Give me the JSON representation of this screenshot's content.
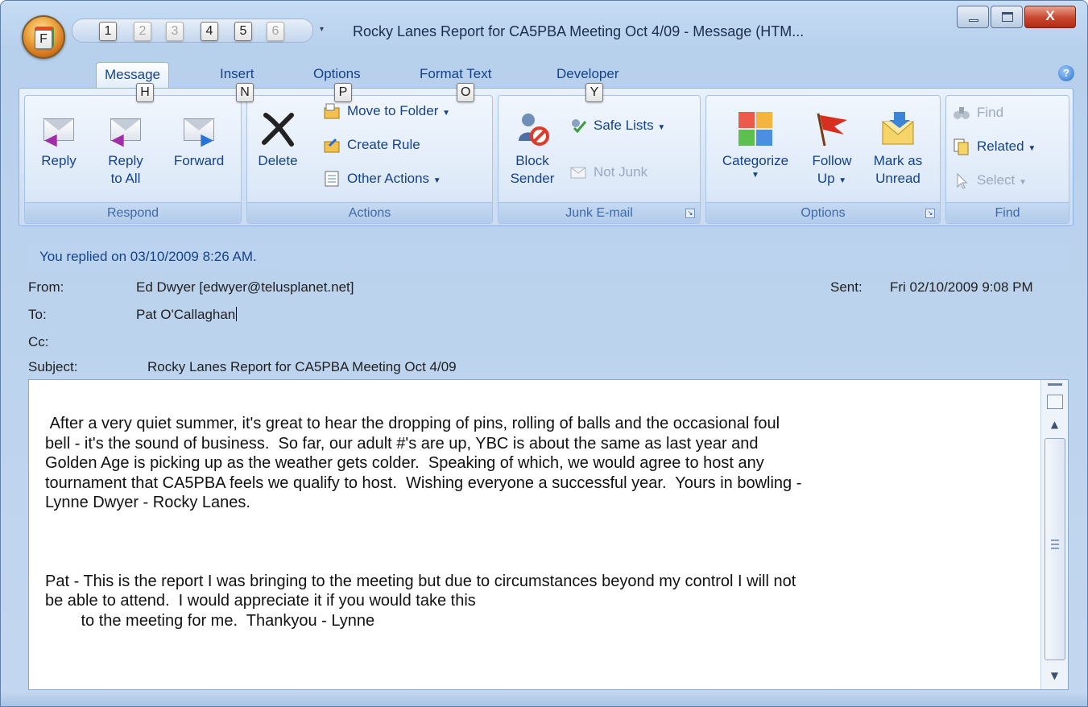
{
  "window": {
    "title": "Rocky Lanes Report for CA5PBA Meeting Oct 4/09 - Message (HTM..."
  },
  "office_button": {
    "keytip": "F"
  },
  "quick_access": {
    "keytips": [
      "1",
      "2",
      "3",
      "4",
      "5",
      "6"
    ],
    "dropdown_glyph": "▾"
  },
  "tabs": [
    {
      "label": "Message",
      "keytip": "H",
      "active": true
    },
    {
      "label": "Insert",
      "keytip": "N"
    },
    {
      "label": "Options",
      "keytip": "P"
    },
    {
      "label": "Format Text",
      "keytip": "O"
    },
    {
      "label": "Developer",
      "keytip": "Y"
    }
  ],
  "ribbon": {
    "respond": {
      "label": "Respond",
      "reply": "Reply",
      "reply_all_line1": "Reply",
      "reply_all_line2": "to All",
      "forward": "Forward"
    },
    "actions": {
      "label": "Actions",
      "delete": "Delete",
      "move_to_folder": "Move to Folder",
      "create_rule": "Create Rule",
      "other_actions": "Other Actions"
    },
    "junk": {
      "label": "Junk E-mail",
      "block_sender_line1": "Block",
      "block_sender_line2": "Sender",
      "safe_lists": "Safe Lists",
      "not_junk": "Not Junk"
    },
    "options": {
      "label": "Options",
      "categorize": "Categorize",
      "follow_up_line1": "Follow",
      "follow_up_line2": "Up",
      "mark_unread_line1": "Mark as",
      "mark_unread_line2": "Unread"
    },
    "find": {
      "label": "Find",
      "find": "Find",
      "related": "Related",
      "select": "Select"
    }
  },
  "message": {
    "info_bar": "You replied on 03/10/2009 8:26 AM.",
    "from_label": "From:",
    "from_value": "Ed Dwyer [edwyer@telusplanet.net]",
    "sent_label": "Sent:",
    "sent_value": "Fri 02/10/2009 9:08 PM",
    "to_label": "To:",
    "to_value": "Pat O'Callaghan",
    "cc_label": "Cc:",
    "cc_value": "",
    "subject_label": "Subject:",
    "subject_value": "Rocky Lanes Report for CA5PBA Meeting Oct 4/09",
    "body_para1": " After a very quiet summer, it's great to hear the dropping of pins, rolling of balls and the occasional foul\nbell - it's the sound of business.  So far, our adult #'s are up, YBC is about the same as last year and\nGolden Age is picking up as the weather gets colder.  Speaking of which, we would agree to host any\ntournament that CA5PBA feels we qualify to host.  Wishing everyone a successful year.  Yours in bowling -\nLynne Dwyer - Rocky Lanes.",
    "body_para2": "Pat - This is the report I was bringing to the meeting but due to circumstances beyond my control I will not\nbe able to attend.  I would appreciate it if you would take this\n        to the meeting for me.  Thankyou - Lynne"
  },
  "colors": {
    "accent": "#15428b",
    "ribbon_bg": "#d4e3f6",
    "close_button": "#c9452e"
  }
}
